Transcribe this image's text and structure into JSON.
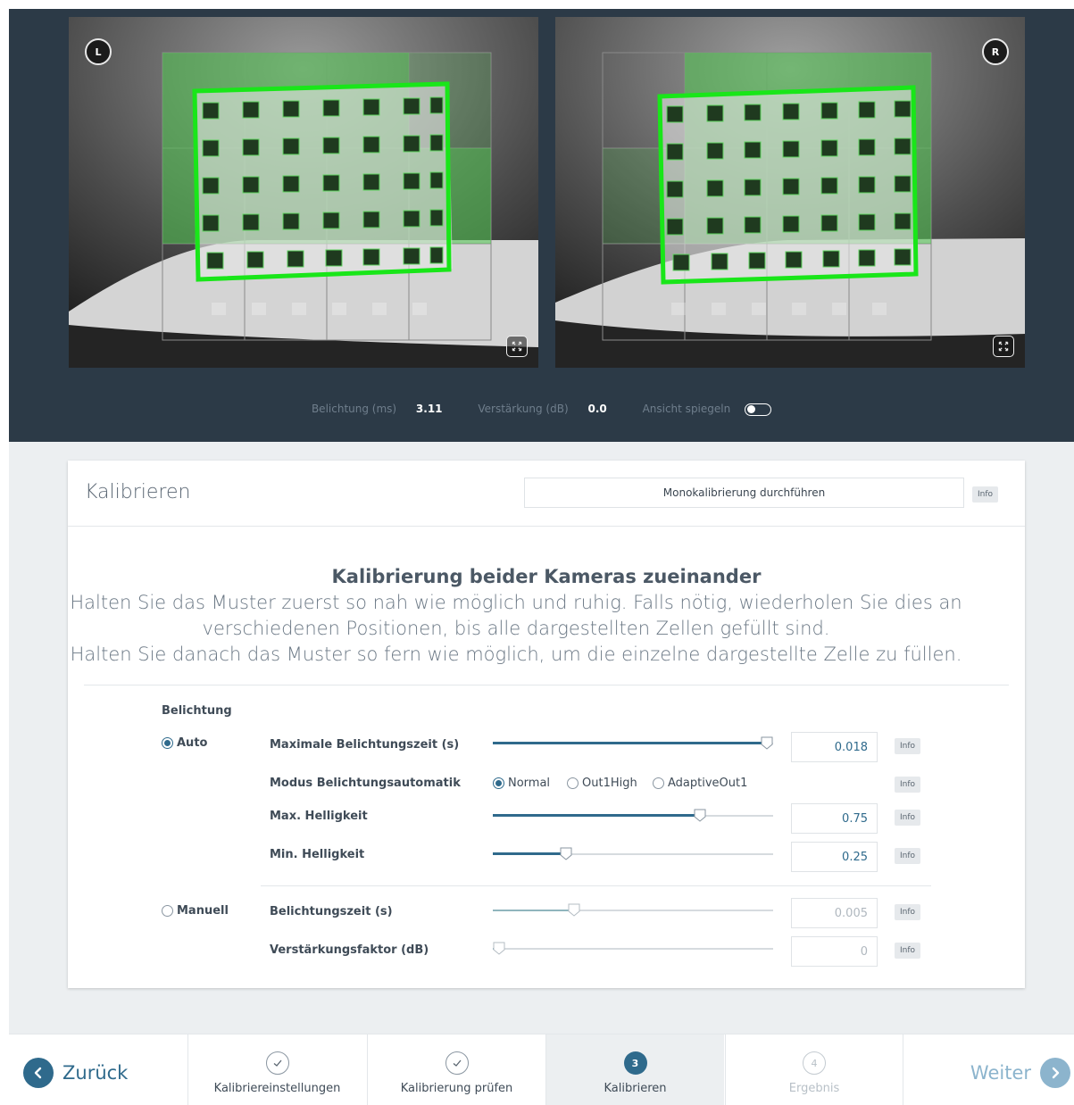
{
  "cameras": {
    "left": {
      "badge": "L"
    },
    "right": {
      "badge": "R"
    }
  },
  "status": {
    "exposure_label": "Belichtung (ms)",
    "exposure_value": "3.11",
    "gain_label": "Verstärkung (dB)",
    "gain_value": "0.0",
    "mirror_label": "Ansicht spiegeln"
  },
  "card": {
    "title": "Kalibrieren",
    "mono_button": "Monokalibrierung durchführen",
    "info": "Info"
  },
  "instructions": {
    "title": "Kalibrierung beider Kameras zueinander",
    "line1": "Halten Sie das Muster zuerst so nah wie möglich und ruhig. Falls nötig, wiederholen Sie dies an",
    "line2": "verschiedenen Positionen, bis alle dargestellten Zellen gefüllt sind.",
    "line3": "Halten Sie danach das Muster so fern wie möglich, um die einzelne dargestellte Zelle zu füllen."
  },
  "exposure": {
    "section_label": "Belichtung",
    "auto_label": "Auto",
    "manual_label": "Manuell",
    "max_exposure": {
      "label": "Maximale Belichtungszeit (s)",
      "value": "0.018",
      "level": 1.0
    },
    "auto_mode": {
      "label": "Modus Belichtungsautomatik",
      "options": [
        "Normal",
        "Out1High",
        "AdaptiveOut1"
      ],
      "selected": "Normal"
    },
    "max_brightness": {
      "label": "Max. Helligkeit",
      "value": "0.75",
      "level": 0.75
    },
    "min_brightness": {
      "label": "Min. Helligkeit",
      "value": "0.25",
      "level": 0.25
    },
    "exposure_time": {
      "label": "Belichtungszeit (s)",
      "value": "0.005",
      "level": 0.28
    },
    "gain_factor": {
      "label": "Verstärkungsfaktor (dB)",
      "value": "0",
      "level": 0.0
    }
  },
  "footer": {
    "back": "Zurück",
    "next": "Weiter",
    "steps": [
      {
        "label": "Kalibriereinstellungen",
        "state": "done"
      },
      {
        "label": "Kalibrierung prüfen",
        "state": "done"
      },
      {
        "label": "Kalibrieren",
        "number": "3",
        "state": "current"
      },
      {
        "label": "Ergebnis",
        "number": "4",
        "state": "todo"
      }
    ]
  },
  "colors": {
    "accent": "#2f6a8c",
    "panel": "#2c3a47",
    "detection": "#19e619"
  }
}
